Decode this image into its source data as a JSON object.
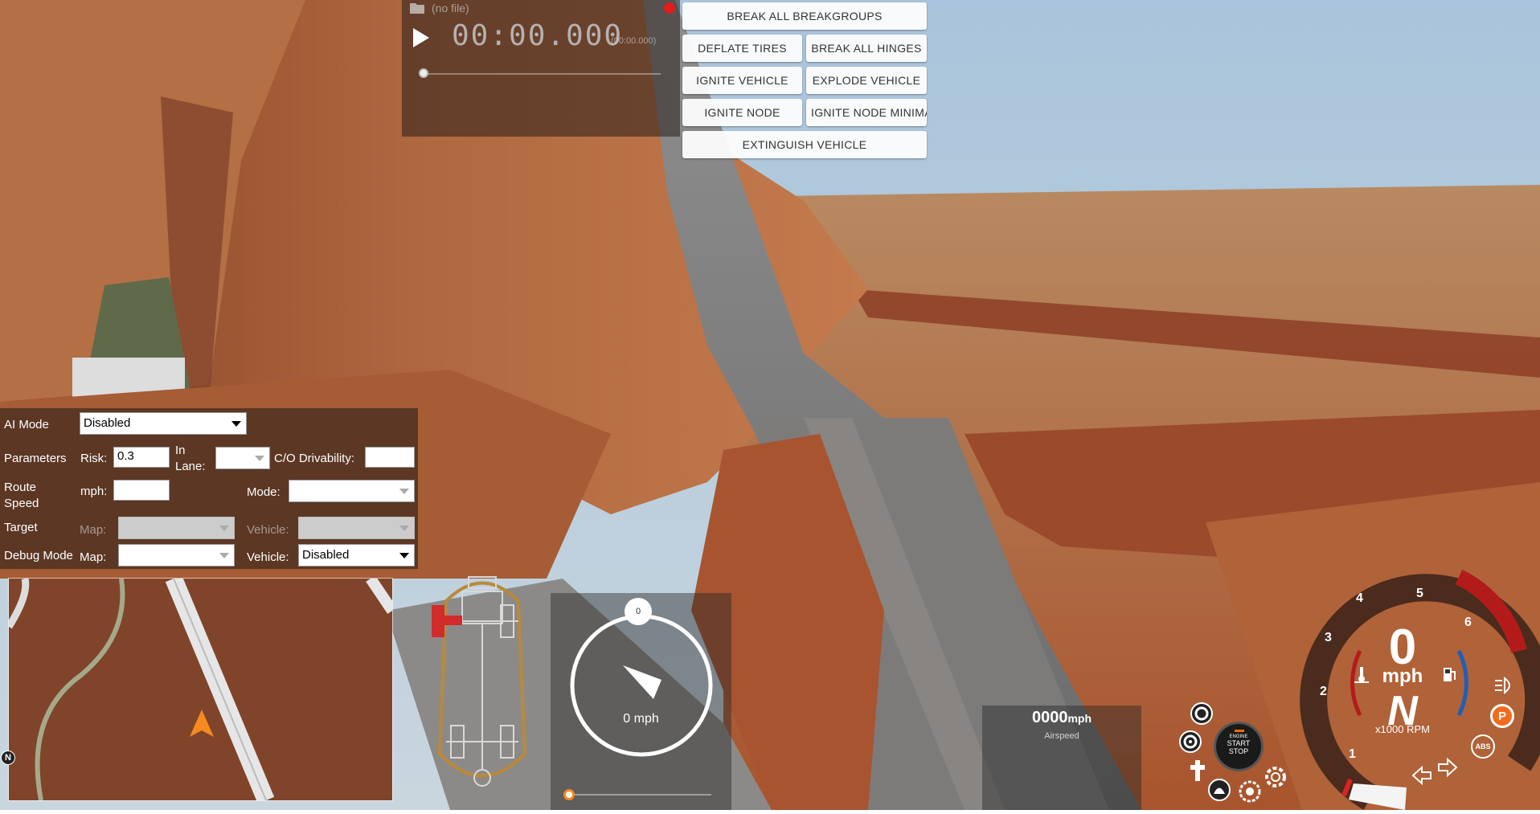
{
  "replay": {
    "file_label": "(no file)",
    "time": "00:00.000",
    "time_total": "(00:00.000)"
  },
  "actions": {
    "break_all_breakgroups": "BREAK ALL BREAKGROUPS",
    "deflate_tires": "DEFLATE TIRES",
    "break_all_hinges": "BREAK ALL HINGES",
    "ignite_vehicle": "IGNITE VEHICLE",
    "explode_vehicle": "EXPLODE VEHICLE",
    "ignite_node": "IGNITE NODE",
    "ignite_node_minimal": "IGNITE NODE MINIMAL",
    "extinguish_vehicle": "EXTINGUISH VEHICLE"
  },
  "ai": {
    "mode_label": "AI Mode",
    "mode_value": "Disabled",
    "parameters_label": "Parameters",
    "risk_label": "Risk:",
    "risk_value": "0.3",
    "in_lane_label_1": "In",
    "in_lane_label_2": "Lane:",
    "co_drivability_label": "C/O Drivability:",
    "route_speed_label_1": "Route",
    "route_speed_label_2": "Speed",
    "mph_label": "mph:",
    "mode2_label": "Mode:",
    "target_label": "Target",
    "target_map_label": "Map:",
    "target_vehicle_label": "Vehicle:",
    "debug_label": "Debug Mode",
    "debug_map_label": "Map:",
    "debug_vehicle_label": "Vehicle:",
    "debug_vehicle_value": "Disabled"
  },
  "minimap": {
    "compass_label": "N"
  },
  "gforce": {
    "top_value": "0",
    "speed_text": "0 mph"
  },
  "airspeed": {
    "value": "0000",
    "unit": "mph",
    "label": "Airspeed"
  },
  "engine": {
    "line1": "ENGINE",
    "line2": "START",
    "line3": "STOP"
  },
  "gauge": {
    "speed": "0",
    "unit": "mph",
    "gear": "N",
    "rpm_label": "x1000 RPM",
    "ticks": [
      "1",
      "2",
      "3",
      "4",
      "5",
      "6"
    ],
    "parking_label": "P",
    "abs_label": "ABS",
    "redline_color": "#b31b1b",
    "parking_color": "#f26b1d"
  }
}
